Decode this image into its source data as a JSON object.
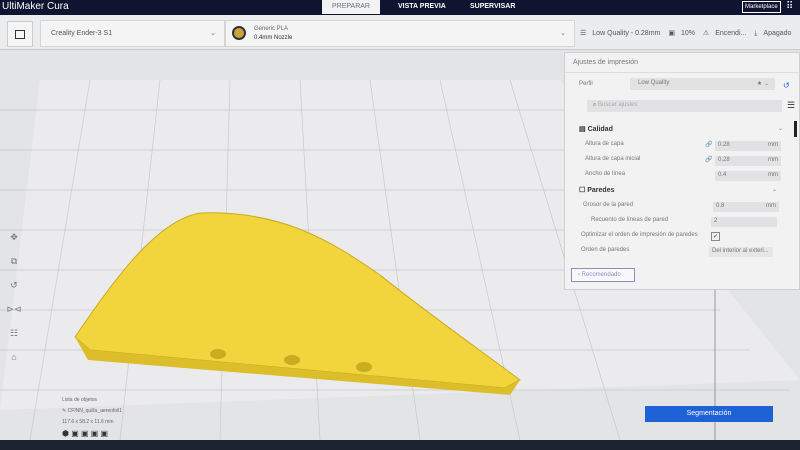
{
  "app": {
    "title": "UltiMaker Cura"
  },
  "tabs": [
    {
      "label": "PREPARAR"
    },
    {
      "label": "VISTA PREVIA"
    },
    {
      "label": "SUPERVISAR"
    }
  ],
  "marketplace": "Marketplace",
  "printer": "Creality Ender-3 S1",
  "material": {
    "name": "Generic PLA",
    "nozzle": "0.4mm Nozzle"
  },
  "summary": {
    "profile": "Low Quality - 0.28mm",
    "infill": "10%",
    "support": "Encendi...",
    "adhesion": "Apagado"
  },
  "panel": {
    "title": "Ajustes de impresión",
    "profile_label": "Perfil",
    "profile_value": "Low Quality",
    "search_placeholder": "Buscar ajustes",
    "sections": [
      {
        "name": "Calidad",
        "settings": [
          {
            "label": "Altura de capa",
            "value": "0.28",
            "unit": "mm"
          },
          {
            "label": "Altura de capa inicial",
            "value": "0.28",
            "unit": "mm"
          },
          {
            "label": "Ancho de línea",
            "value": "0.4",
            "unit": "mm"
          }
        ]
      },
      {
        "name": "Paredes",
        "settings": [
          {
            "label": "Grosor de la pared",
            "value": "0.8",
            "unit": "mm"
          },
          {
            "label": "Recuento de líneas de pared",
            "value": "2",
            "unit": ""
          },
          {
            "label": "Optimizar el orden de impresión de paredes",
            "value": "✔",
            "unit": ""
          },
          {
            "label": "Orden de paredes",
            "value": "Del interior al exteri...",
            "unit": ""
          }
        ]
      }
    ],
    "recommended": "Recomendado"
  },
  "object": {
    "list": "Lista de objetos",
    "name": "CFINN_quilla_aereofoil1",
    "dims": "117.6 x 58.2 x 11.6 mm"
  },
  "slice_button": "Segmentación",
  "colors": {
    "accent": "#1f62d7",
    "model": "#f2d43c",
    "topbar": "#0f1530"
  }
}
